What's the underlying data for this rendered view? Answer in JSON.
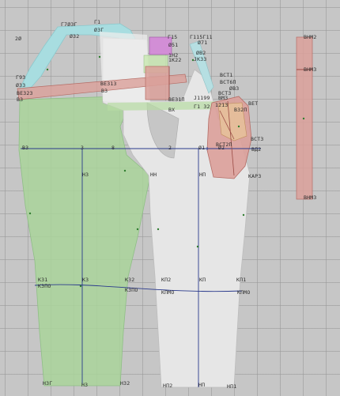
{
  "labels": {
    "l_17031": "Г7Ø3Г",
    "l_t1": "Г1",
    "l_20": "2Ø",
    "l_0032": "Ø32",
    "l_0031": "Ø3Г",
    "l_193": "Г93",
    "l_0033": "Ø33",
    "l_13313": "ВЕ313",
    "l_13323": "ВЕ323",
    "l_133": "ВЗ",
    "l_13": "В3",
    "l_215": "Г15",
    "l_2115": "Г115Г11",
    "l_0071": "Ø71",
    "l_0051": "Ø51",
    "l_142": "1Н2",
    "l_0bn2": "ØВ2",
    "l_1k22": "1К22",
    "l_jk33": "ЈК33",
    "l_bcm1": "ВСТ1",
    "l_bcm": "ВСТ6П",
    "l_0d3": "ØВ3",
    "l_be31n": "ВЕ31П",
    "l_j1199": "Ј1199",
    "l_bcm3": "ВСТ3",
    "l_bm3": "ВМ3",
    "l_bet": "ВЕТ",
    "l_b32n": "В32П",
    "l_bx": "ВХ",
    "l_21": "Г1 32",
    "l_1213": "1213",
    "l_bct2": "ВСТ2П",
    "l_bct3": "ВСТ3",
    "l_bd2": "ВД2",
    "l_kb2": "КАР3",
    "l_b3a": "В3",
    "l_3": "3",
    "l_8": "8",
    "l_2": "2",
    "l_01": "Ø1",
    "l_02": "Ø2",
    "l_h3": "Н3",
    "l_hh": "НН",
    "l_hn": "НП",
    "l_k31": "К31",
    "l_k3": "К3",
    "l_k32": "К32",
    "l_kn2": "КП2",
    "l_kn": "КП",
    "l_kn1": "КП1",
    "l_k3nd": "К3ПО",
    "l_k3nd2": "К3ПО",
    "l_knmd": "КПМО",
    "l_knmd2": "КПМО",
    "l_h31": "Н3Г",
    "l_h3b": "Н3",
    "l_h32": "Н32",
    "l_hn2": "НП2",
    "l_hn_b": "НП",
    "l_hn1": "НП1",
    "l_bnm2": "ВНМ2",
    "l_bnm3": "ВНМ3",
    "l_bnm3b": "ВНМ3"
  },
  "colors": {
    "green_piece": "#a9d49a",
    "white_piece": "#e6e6e6",
    "pink_piece": "#dba09a",
    "cyan_piece": "#a8dde0",
    "magenta_piece": "#d28ed6",
    "guide_line": "#2a3a8c"
  }
}
